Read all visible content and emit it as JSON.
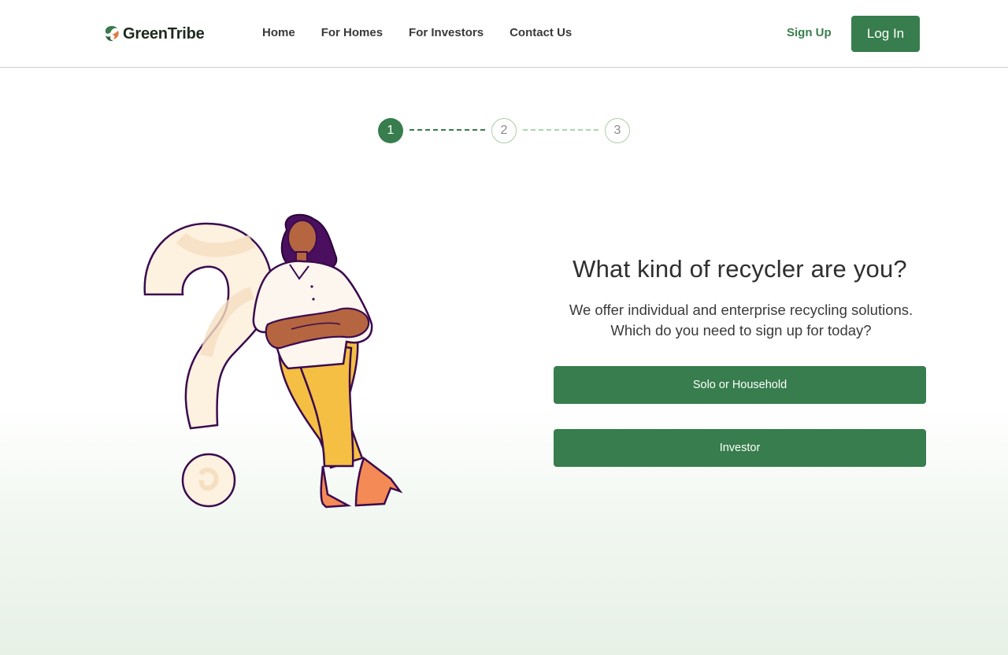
{
  "brand": {
    "name": "GreenTribe",
    "colors": {
      "primary": "#377d4d",
      "accent_orange": "#e07a3f"
    }
  },
  "nav": {
    "items": [
      {
        "label": "Home"
      },
      {
        "label": "For Homes"
      },
      {
        "label": "For Investors"
      },
      {
        "label": "Contact Us"
      }
    ]
  },
  "auth": {
    "signup_label": "Sign Up",
    "login_label": "Log In"
  },
  "stepper": {
    "steps": [
      {
        "label": "1",
        "state": "active"
      },
      {
        "label": "2",
        "state": "pending"
      },
      {
        "label": "3",
        "state": "pending"
      }
    ]
  },
  "main": {
    "headline": "What kind of recycler are you?",
    "subtext_line1": "We offer individual and enterprise recycling solutions.",
    "subtext_line2": "Which do you need to sign up for today?",
    "options": [
      {
        "label": "Solo or Household"
      },
      {
        "label": "Investor"
      }
    ],
    "illustration": "woman-leaning-on-question-mark"
  }
}
